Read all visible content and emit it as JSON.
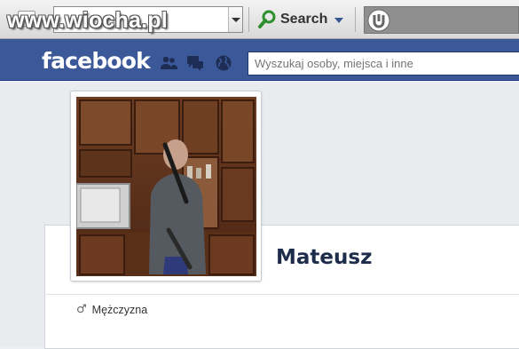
{
  "watermark": "www.wiocha.pl",
  "browser": {
    "search_label": "Search"
  },
  "facebook": {
    "logo": "facebook",
    "nav_icons": [
      "friends-icon",
      "messages-icon",
      "globe-icon"
    ],
    "search_placeholder": "Wyszukaj osoby, miejsca i inne",
    "brand_color": "#3b5998"
  },
  "profile": {
    "name": "Mateusz",
    "gender_symbol": "♂",
    "gender_label": "Mężczyzna"
  }
}
